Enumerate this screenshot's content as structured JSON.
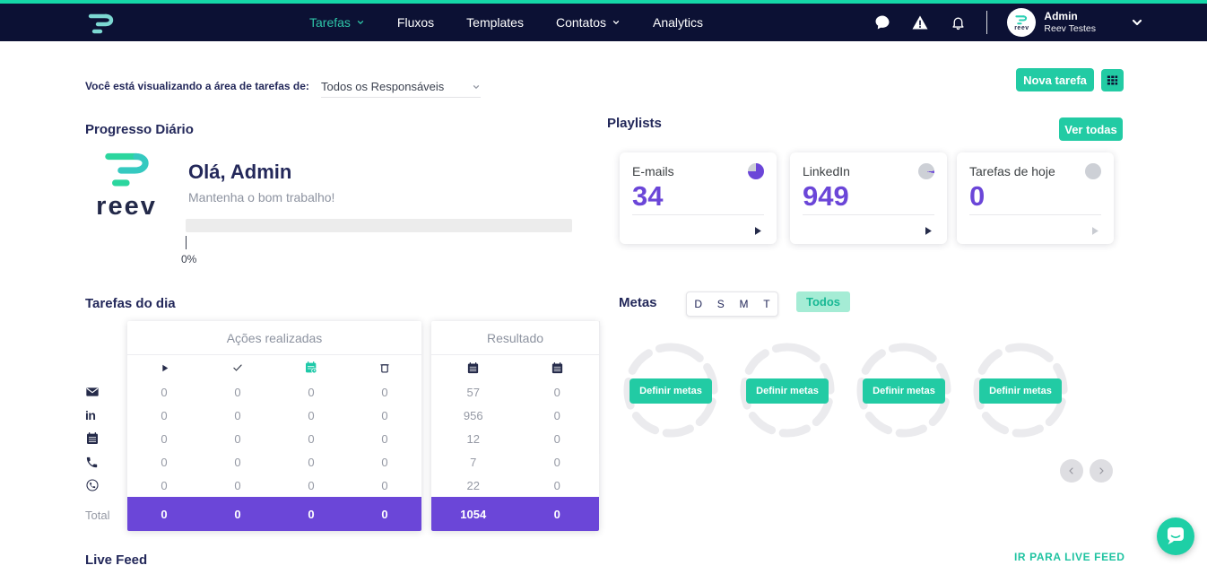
{
  "navbar": {
    "brand": "reev",
    "links": [
      {
        "label": "Tarefas"
      },
      {
        "label": "Fluxos"
      },
      {
        "label": "Templates"
      },
      {
        "label": "Contatos"
      },
      {
        "label": "Analytics"
      }
    ],
    "user": {
      "name": "Admin",
      "org": "Reev Testes"
    }
  },
  "toolbar": {
    "viewing_label": "Você está visualizando a área de tarefas de:",
    "responsible_selected": "Todos os Responsáveis",
    "new_task_label": "Nova tarefa"
  },
  "daily_progress": {
    "title": "Progresso Diário",
    "greeting": "Olá, Admin",
    "subtitle": "Mantenha o bom trabalho!",
    "percent_label": "0%",
    "brand_wordmark": "reev"
  },
  "playlists": {
    "title": "Playlists",
    "see_all_label": "Ver todas",
    "cards": [
      {
        "label": "E-mails",
        "value": "34"
      },
      {
        "label": "LinkedIn",
        "value": "949"
      },
      {
        "label": "Tarefas de hoje",
        "value": "0"
      }
    ]
  },
  "tasks_table": {
    "title": "Tarefas do dia",
    "actions_header": "Ações realizadas",
    "results_header": "Resultado",
    "rows": [
      {
        "channel": "email",
        "actions": [
          "0",
          "0",
          "0",
          "0"
        ],
        "results": [
          "57",
          "0"
        ]
      },
      {
        "channel": "linkedin",
        "actions": [
          "0",
          "0",
          "0",
          "0"
        ],
        "results": [
          "956",
          "0"
        ]
      },
      {
        "channel": "calendar",
        "actions": [
          "0",
          "0",
          "0",
          "0"
        ],
        "results": [
          "12",
          "0"
        ]
      },
      {
        "channel": "phone",
        "actions": [
          "0",
          "0",
          "0",
          "0"
        ],
        "results": [
          "7",
          "0"
        ]
      },
      {
        "channel": "whatsapp",
        "actions": [
          "0",
          "0",
          "0",
          "0"
        ],
        "results": [
          "22",
          "0"
        ]
      }
    ],
    "total": {
      "label": "Total",
      "actions": [
        "0",
        "0",
        "0",
        "0"
      ],
      "results": [
        "1054",
        "0"
      ]
    }
  },
  "metas": {
    "title": "Metas",
    "period_options": [
      "D",
      "S",
      "M",
      "T"
    ],
    "all_option": "Todos",
    "define_button_label": "Definir metas"
  },
  "live_feed": {
    "title": "Live Feed",
    "go_to_label": "IR PARA LIVE FEED"
  },
  "icons": {
    "linkedin_glyph": "in"
  },
  "colors": {
    "accent_teal": "#22cba4",
    "purple": "#6b46d8",
    "navy": "#0c1134"
  }
}
